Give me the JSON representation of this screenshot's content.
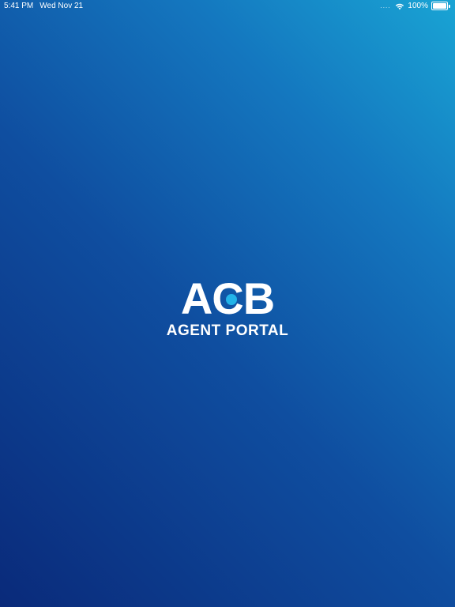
{
  "status_bar": {
    "time": "5:41 PM",
    "date": "Wed Nov 21",
    "signal_dots": "....",
    "battery_percent": "100%",
    "battery_level": 1.0
  },
  "logo": {
    "letter_a": "A",
    "letter_c": "C",
    "letter_b": "B",
    "subtitle": "AGENT PORTAL",
    "dot_color": "#23b4e8"
  },
  "colors": {
    "gradient_start": "#0a2a7a",
    "gradient_end": "#19a4d4",
    "text": "#ffffff"
  },
  "icons": {
    "wifi": "wifi-icon",
    "battery": "battery-icon"
  }
}
